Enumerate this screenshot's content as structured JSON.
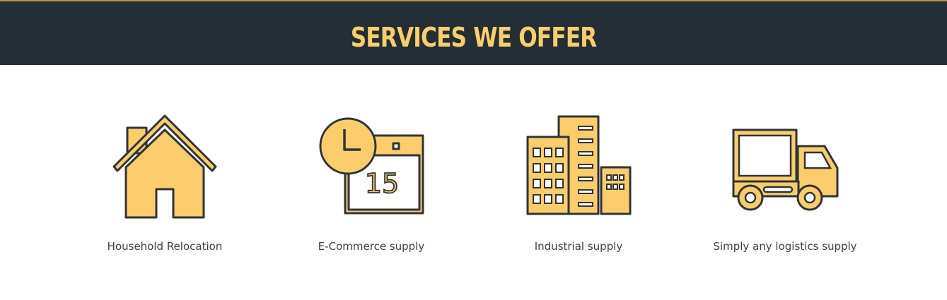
{
  "header": {
    "title": "SERVICES WE OFFER"
  },
  "colors": {
    "header_bg": "#232e35",
    "accent": "#fdcd6c",
    "outline": "#2f3438",
    "label_text": "#3b4148"
  },
  "services": [
    {
      "label": "Household Relocation",
      "icon": "house-icon"
    },
    {
      "label": "E-Commerce supply",
      "icon": "clock-calendar-icon",
      "calendar_day": "15"
    },
    {
      "label": "Industrial supply",
      "icon": "buildings-icon"
    },
    {
      "label": "Simply any logistics supply",
      "icon": "delivery-truck-icon"
    }
  ]
}
